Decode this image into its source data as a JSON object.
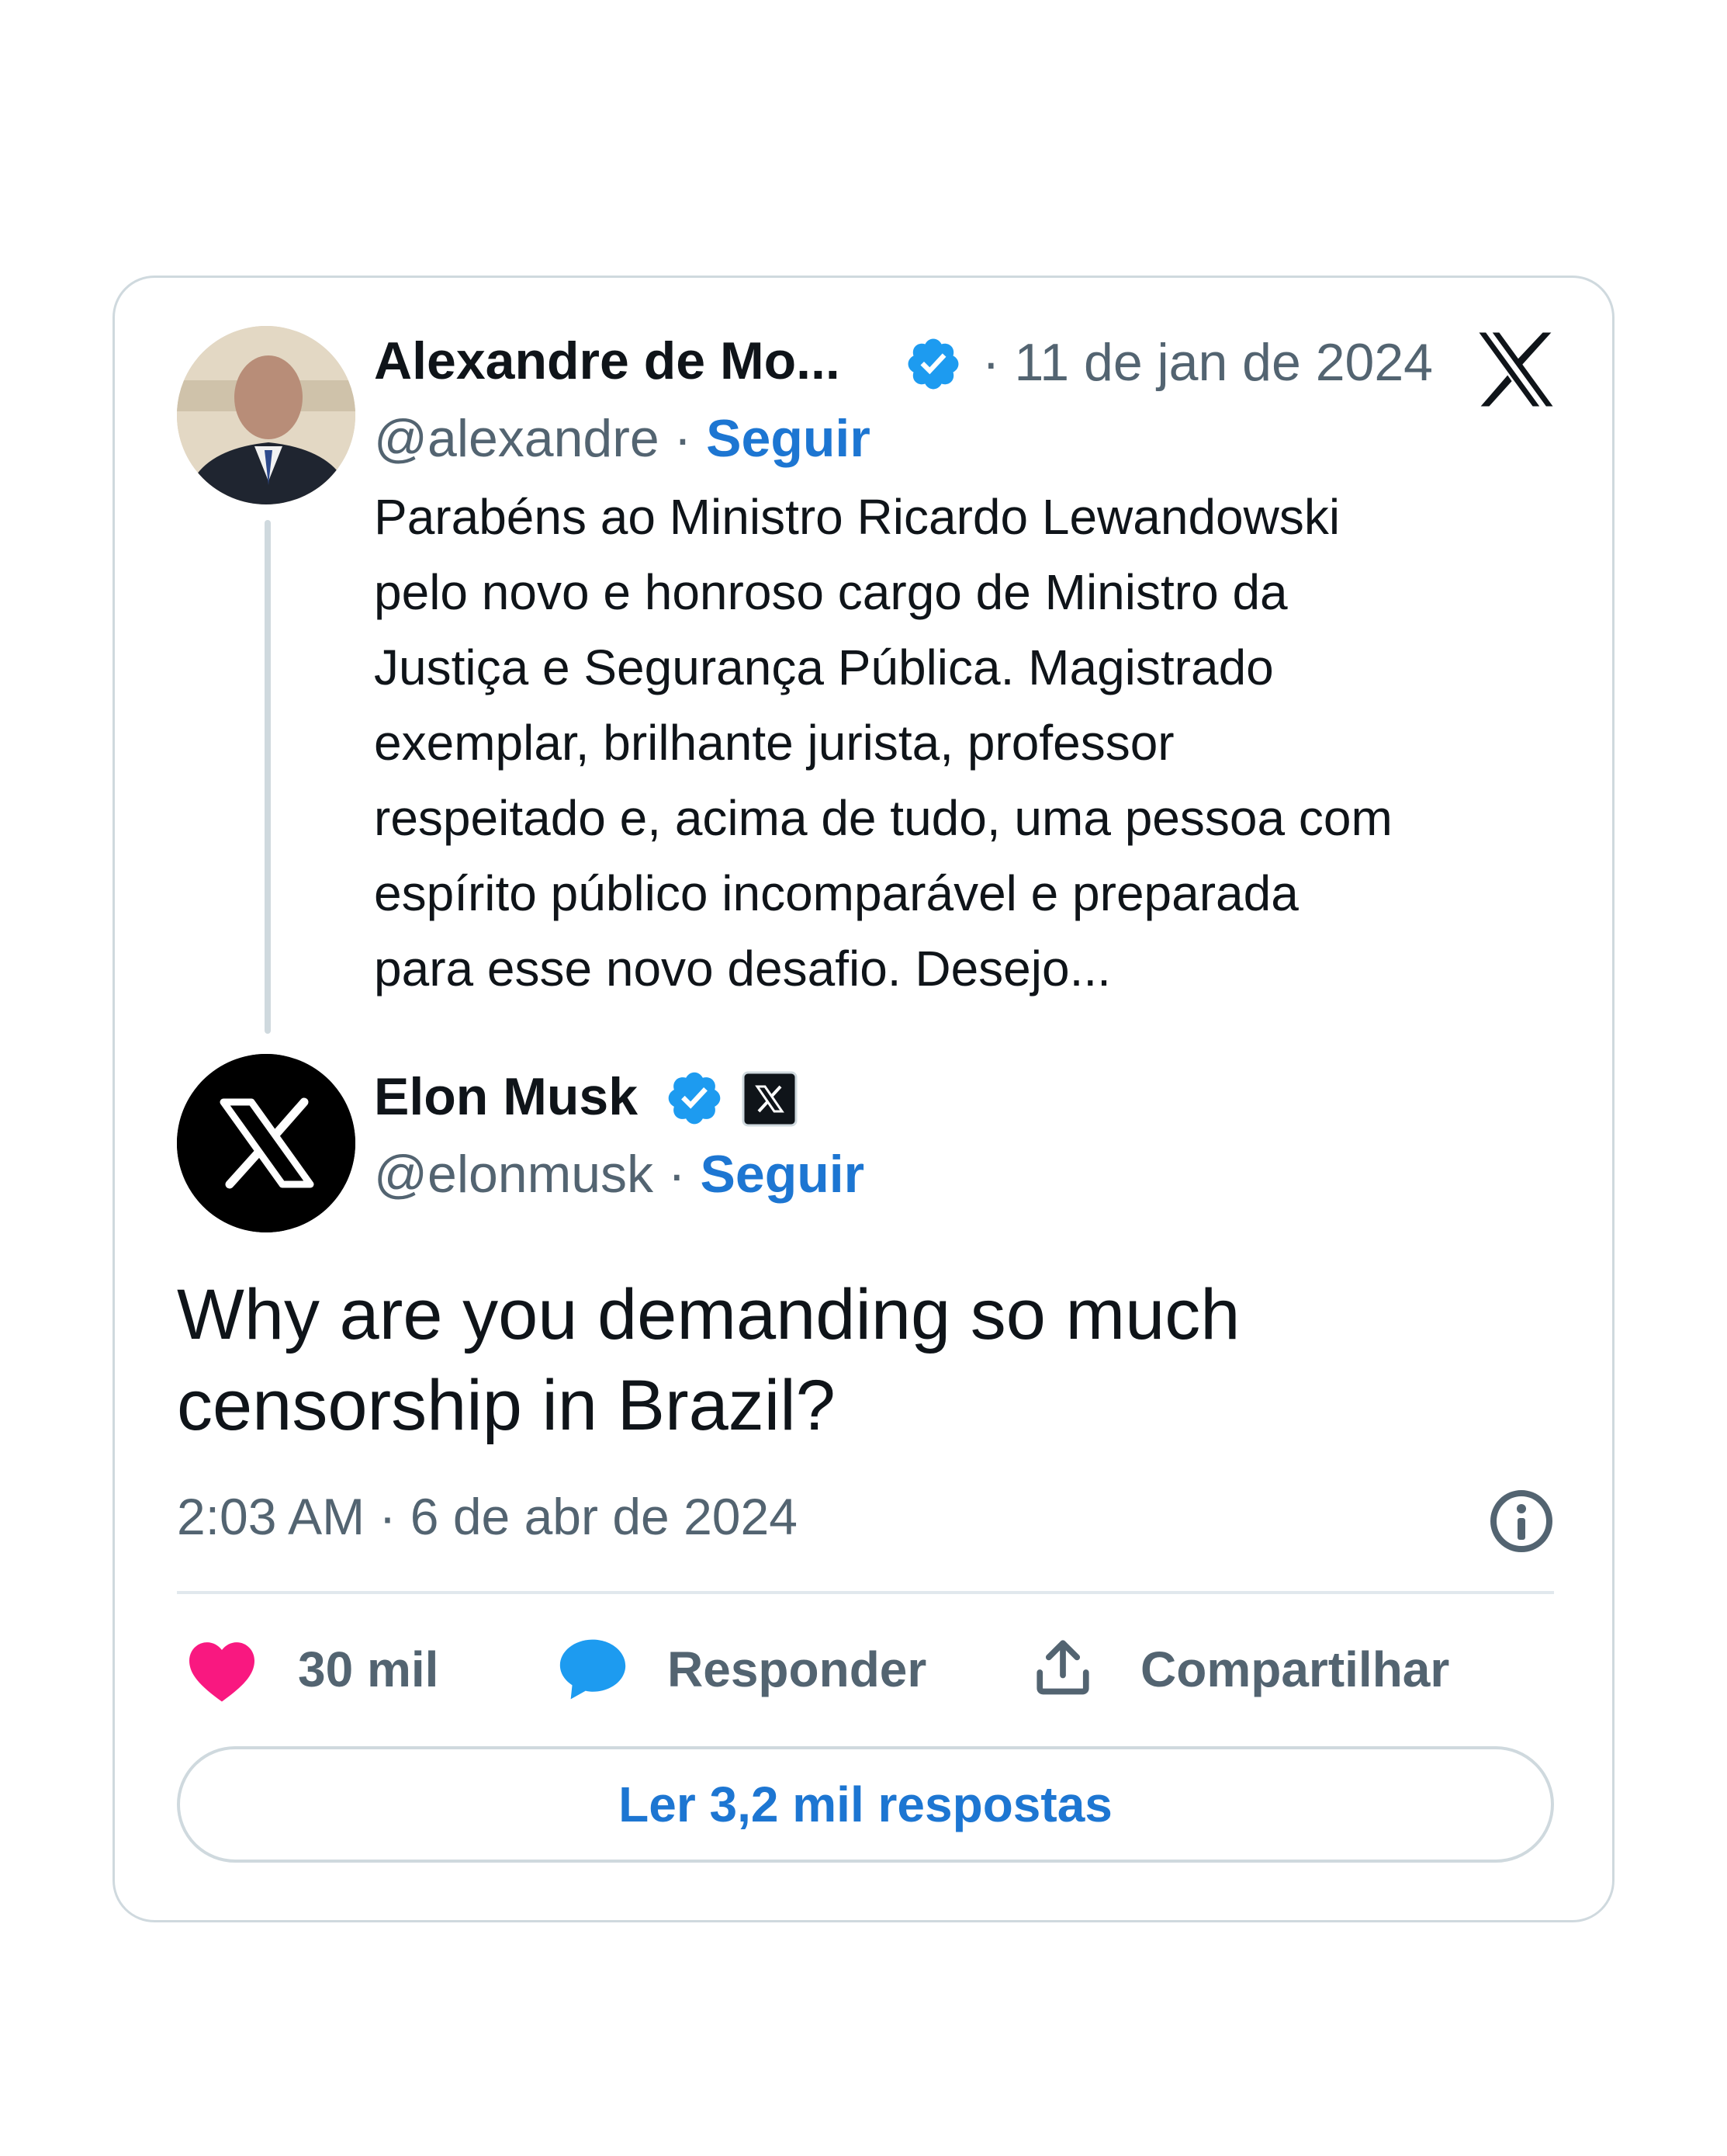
{
  "quoted_tweet": {
    "author_name": "Alexandre de Mo...",
    "date": "· 11 de jan de 2024",
    "handle": "@alexandre",
    "separator": "·",
    "follow_label": "Seguir",
    "text": "Parabéns ao Ministro Ricardo Lewandowski\npelo novo e honroso cargo de Ministro da\nJustiça e Segurança Pública. Magistrado\nexemplar, brilhante jurista, professor\nrespeitado e, acima de tudo, uma pessoa com\nespírito público incomparável e preparada\npara esse novo desafio. Desejo..."
  },
  "main_tweet": {
    "author_name": "Elon Musk",
    "handle": "@elonmusk",
    "separator": "·",
    "follow_label": "Seguir",
    "text": "Why are you demanding so much censorship in Brazil?",
    "timestamp": "2:03 AM · 6 de abr de 2024"
  },
  "actions": {
    "likes": "30 mil",
    "reply_label": "Responder",
    "share_label": "Compartilhar"
  },
  "read_replies_label": "Ler 3,2 mil respostas",
  "icons": {
    "brand": "x-logo-icon",
    "verified": "verified-badge-icon",
    "affiliate": "x-affiliate-badge-icon",
    "info": "info-icon",
    "like": "heart-icon",
    "reply": "reply-bubble-icon",
    "share": "share-icon"
  },
  "colors": {
    "verified": "#1d9bf0",
    "link": "#1d76d2",
    "heart": "#f91880",
    "border": "#cfd9de",
    "muted": "#536471"
  }
}
